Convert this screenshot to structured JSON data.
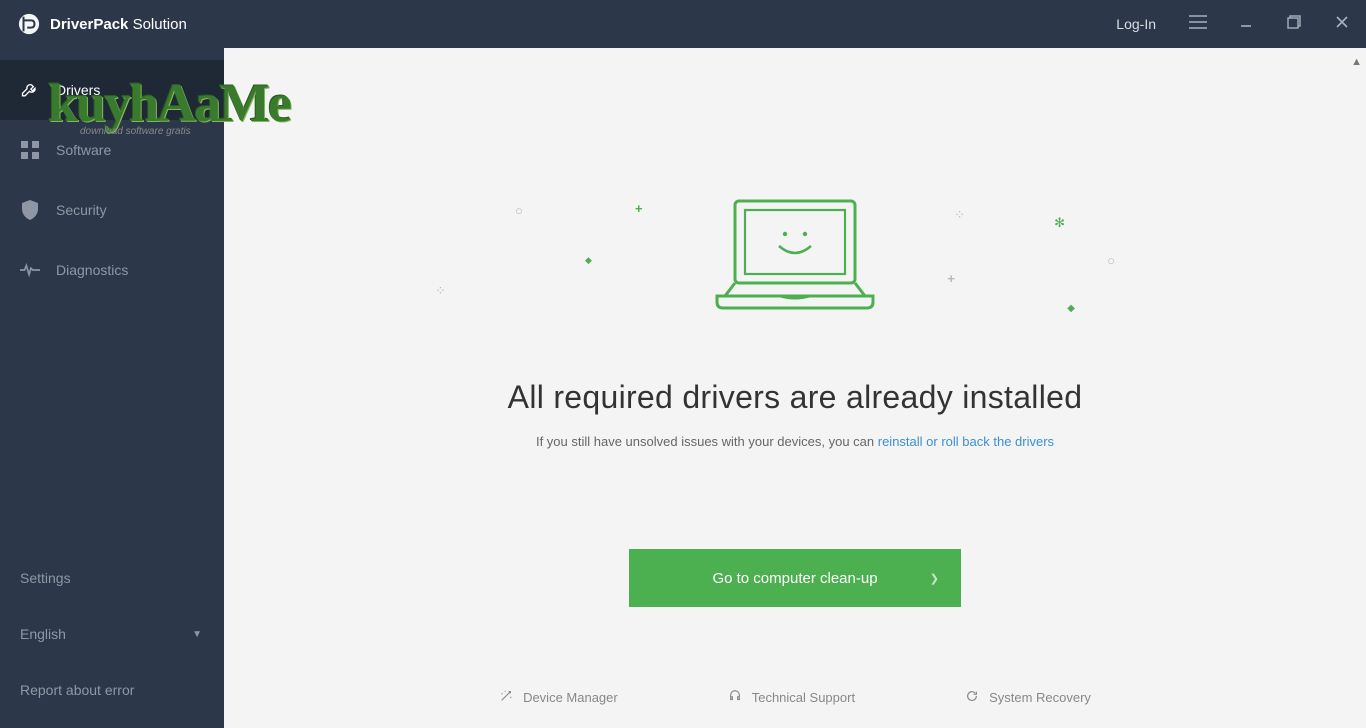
{
  "header": {
    "brand_bold": "DriverPack",
    "brand_light": " Solution",
    "login": "Log-In"
  },
  "sidebar": {
    "items": [
      {
        "label": "Drivers"
      },
      {
        "label": "Software"
      },
      {
        "label": "Security"
      },
      {
        "label": "Diagnostics"
      }
    ],
    "settings": "Settings",
    "language": "English",
    "report": "Report about error"
  },
  "main": {
    "title": "All required drivers are already installed",
    "subtitle_prefix": "If you still have unsolved issues with your devices, you can ",
    "subtitle_link": "reinstall or roll back the drivers",
    "cta": "Go to computer clean-up"
  },
  "footer": {
    "device_manager": "Device Manager",
    "tech_support": "Technical Support",
    "system_recovery": "System Recovery"
  },
  "watermark": {
    "main": "kuyhAaMe",
    "sub": "download software gratis"
  },
  "colors": {
    "accent": "#4caf50",
    "sidebar": "#2c3849"
  }
}
